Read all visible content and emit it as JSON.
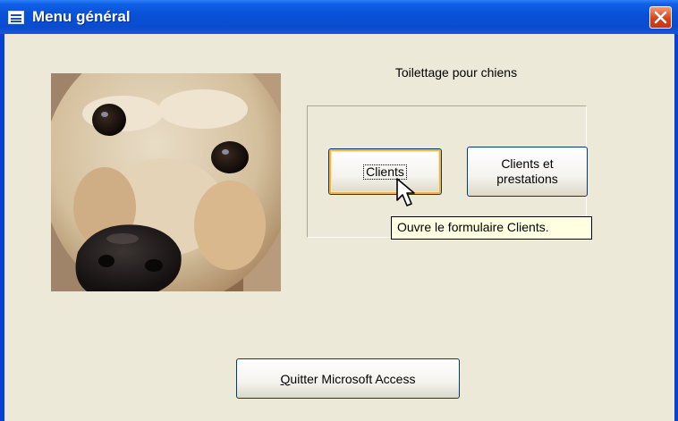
{
  "window": {
    "title": "Menu général",
    "icons": {
      "app": "form-icon",
      "close": "close-icon"
    },
    "colors": {
      "titlebar": "#0a4ccf",
      "body": "#ece9d8",
      "close": "#d9401b"
    }
  },
  "form": {
    "subtitle": "Toilettage pour chiens",
    "photo_icon": "dog-photo",
    "buttons": {
      "clients": "Clients",
      "clients_prestations_line1": "Clients et",
      "clients_prestations_line2": "prestations",
      "quit_access_key": "Q",
      "quit_rest": "uitter Microsoft Access"
    },
    "tooltip": "Ouvre le formulaire Clients."
  }
}
